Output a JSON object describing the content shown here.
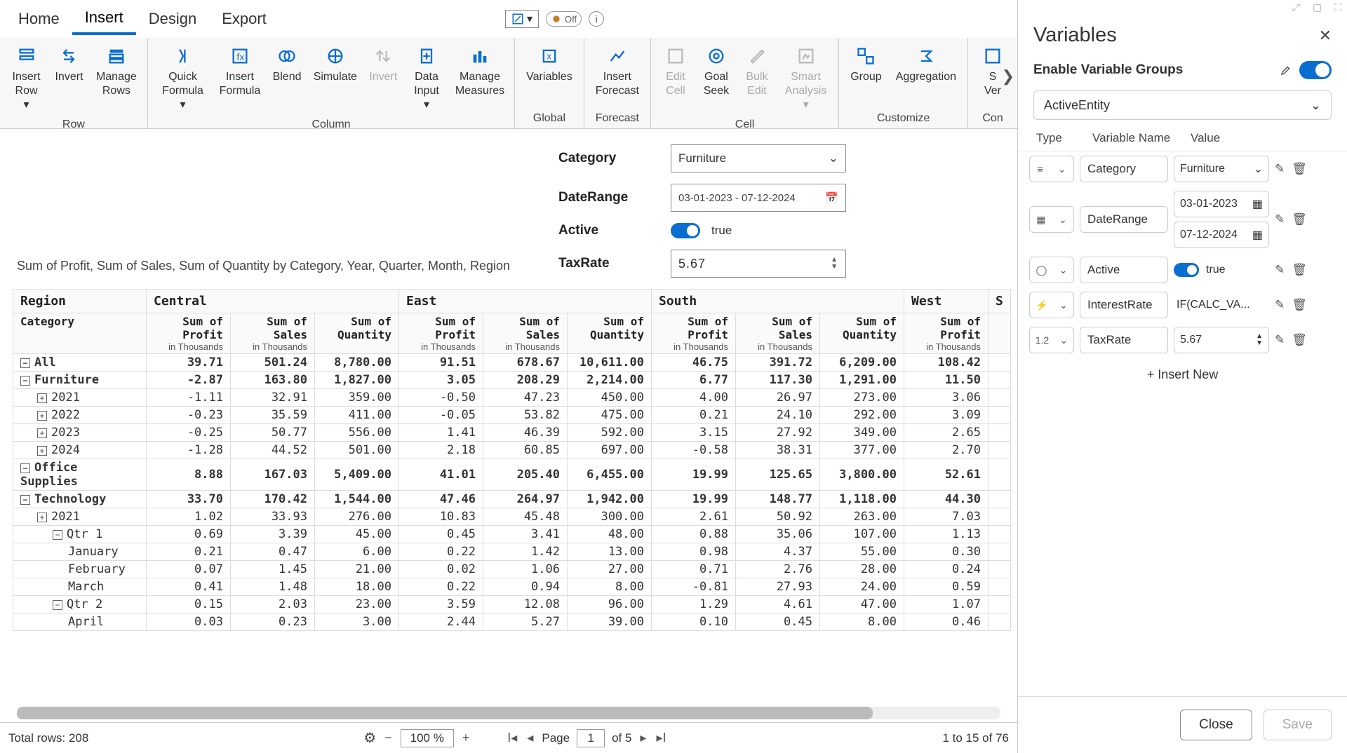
{
  "menu": {
    "home": "Home",
    "insert": "Insert",
    "design": "Design",
    "export": "Export",
    "toggle_label": "Off"
  },
  "ribbon": {
    "row": {
      "label": "Row",
      "insert_row": "Insert\nRow ▾",
      "invert": "Invert",
      "manage_rows": "Manage\nRows"
    },
    "column": {
      "label": "Column",
      "quick_formula": "Quick\nFormula ▾",
      "insert_formula": "Insert\nFormula",
      "blend": "Blend",
      "simulate": "Simulate",
      "invert": "Invert",
      "data_input": "Data\nInput ▾",
      "manage_measures": "Manage\nMeasures"
    },
    "global": {
      "label": "Global",
      "variables": "Variables"
    },
    "forecast": {
      "label": "Forecast",
      "insert_forecast": "Insert\nForecast"
    },
    "cell": {
      "label": "Cell",
      "edit_cell": "Edit\nCell",
      "goal_seek": "Goal\nSeek",
      "bulk_edit": "Bulk\nEdit",
      "smart_analysis": "Smart\nAnalysis ▾"
    },
    "customize": {
      "label": "Customize",
      "group": "Group",
      "aggregation": "Aggregation"
    },
    "con": {
      "label": "Con",
      "ver": "S\nVer"
    }
  },
  "filters": {
    "subtitle": "Sum of Profit, Sum of Sales, Sum of Quantity by Category, Year, Quarter, Month, Region",
    "category_label": "Category",
    "category_value": "Furniture",
    "daterange_label": "DateRange",
    "daterange_value": "03-01-2023 - 07-12-2024",
    "active_label": "Active",
    "active_value": "true",
    "taxrate_label": "TaxRate",
    "taxrate_value": "5.67"
  },
  "table": {
    "region_header": "Region",
    "category_header": "Category",
    "regions": [
      "Central",
      "East",
      "South",
      "West"
    ],
    "measures": [
      "Sum of Profit",
      "Sum of Sales",
      "Sum of Quantity"
    ],
    "measure_sub": "in Thousands",
    "rows": [
      {
        "label": "All",
        "indent": 0,
        "bold": true,
        "exp": "⊟",
        "v": [
          "39.71",
          "501.24",
          "8,780.00",
          "91.51",
          "678.67",
          "10,611.00",
          "46.75",
          "391.72",
          "6,209.00",
          "108.42"
        ]
      },
      {
        "label": "Furniture",
        "indent": 0,
        "bold": true,
        "exp": "⊟",
        "v": [
          "-2.87",
          "163.80",
          "1,827.00",
          "3.05",
          "208.29",
          "2,214.00",
          "6.77",
          "117.30",
          "1,291.00",
          "11.50"
        ]
      },
      {
        "label": "2021",
        "indent": 1,
        "bold": false,
        "exp": "⊞",
        "v": [
          "-1.11",
          "32.91",
          "359.00",
          "-0.50",
          "47.23",
          "450.00",
          "4.00",
          "26.97",
          "273.00",
          "3.06"
        ]
      },
      {
        "label": "2022",
        "indent": 1,
        "bold": false,
        "exp": "⊞",
        "v": [
          "-0.23",
          "35.59",
          "411.00",
          "-0.05",
          "53.82",
          "475.00",
          "0.21",
          "24.10",
          "292.00",
          "3.09"
        ]
      },
      {
        "label": "2023",
        "indent": 1,
        "bold": false,
        "exp": "⊞",
        "v": [
          "-0.25",
          "50.77",
          "556.00",
          "1.41",
          "46.39",
          "592.00",
          "3.15",
          "27.92",
          "349.00",
          "2.65"
        ]
      },
      {
        "label": "2024",
        "indent": 1,
        "bold": false,
        "exp": "⊞",
        "v": [
          "-1.28",
          "44.52",
          "501.00",
          "2.18",
          "60.85",
          "697.00",
          "-0.58",
          "38.31",
          "377.00",
          "2.70"
        ]
      },
      {
        "label": "Office Supplies",
        "indent": 0,
        "bold": true,
        "exp": "⊟",
        "v": [
          "8.88",
          "167.03",
          "5,409.00",
          "41.01",
          "205.40",
          "6,455.00",
          "19.99",
          "125.65",
          "3,800.00",
          "52.61"
        ]
      },
      {
        "label": "Technology",
        "indent": 0,
        "bold": true,
        "exp": "⊟",
        "v": [
          "33.70",
          "170.42",
          "1,544.00",
          "47.46",
          "264.97",
          "1,942.00",
          "19.99",
          "148.77",
          "1,118.00",
          "44.30"
        ]
      },
      {
        "label": "2021",
        "indent": 1,
        "bold": false,
        "exp": "⊞",
        "v": [
          "1.02",
          "33.93",
          "276.00",
          "10.83",
          "45.48",
          "300.00",
          "2.61",
          "50.92",
          "263.00",
          "7.03"
        ]
      },
      {
        "label": "Qtr 1",
        "indent": 2,
        "bold": false,
        "exp": "⊟",
        "v": [
          "0.69",
          "3.39",
          "45.00",
          "0.45",
          "3.41",
          "48.00",
          "0.88",
          "35.06",
          "107.00",
          "1.13"
        ]
      },
      {
        "label": "January",
        "indent": 3,
        "bold": false,
        "exp": "",
        "v": [
          "0.21",
          "0.47",
          "6.00",
          "0.22",
          "1.42",
          "13.00",
          "0.98",
          "4.37",
          "55.00",
          "0.30"
        ]
      },
      {
        "label": "February",
        "indent": 3,
        "bold": false,
        "exp": "",
        "v": [
          "0.07",
          "1.45",
          "21.00",
          "0.02",
          "1.06",
          "27.00",
          "0.71",
          "2.76",
          "28.00",
          "0.24"
        ]
      },
      {
        "label": "March",
        "indent": 3,
        "bold": false,
        "exp": "",
        "v": [
          "0.41",
          "1.48",
          "18.00",
          "0.22",
          "0.94",
          "8.00",
          "-0.81",
          "27.93",
          "24.00",
          "0.59"
        ]
      },
      {
        "label": "Qtr 2",
        "indent": 2,
        "bold": false,
        "exp": "⊟",
        "v": [
          "0.15",
          "2.03",
          "23.00",
          "3.59",
          "12.08",
          "96.00",
          "1.29",
          "4.61",
          "47.00",
          "1.07"
        ]
      },
      {
        "label": "April",
        "indent": 3,
        "bold": false,
        "exp": "",
        "v": [
          "0.03",
          "0.23",
          "3.00",
          "2.44",
          "5.27",
          "39.00",
          "0.10",
          "0.45",
          "8.00",
          "0.46"
        ]
      }
    ]
  },
  "status": {
    "total_rows": "Total rows: 208",
    "zoom": "100 %",
    "page_label": "Page",
    "page_value": "1",
    "page_of": "of 5",
    "range": "1 to 15 of 76"
  },
  "vars_panel": {
    "title": "Variables",
    "enable_label": "Enable Variable Groups",
    "entity": "ActiveEntity",
    "col_type": "Type",
    "col_name": "Variable Name",
    "col_value": "Value",
    "rows": [
      {
        "name": "Category",
        "value": "Furniture",
        "kind": "select"
      },
      {
        "name": "DateRange",
        "value": "03-01-2023",
        "value2": "07-12-2024",
        "kind": "daterange"
      },
      {
        "name": "Active",
        "value": "true",
        "kind": "switch"
      },
      {
        "name": "InterestRate",
        "value": "IF(CALC_VA...",
        "kind": "formula"
      },
      {
        "name": "TaxRate",
        "value": "5.67",
        "kind": "number",
        "type_icon": "1.2"
      }
    ],
    "insert_new": "+   Insert New",
    "close": "Close",
    "save": "Save"
  }
}
